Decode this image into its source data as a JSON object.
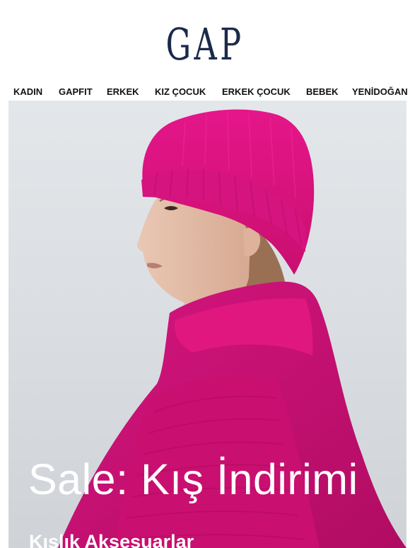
{
  "brand": {
    "logo_text": "GAP",
    "logo_color": "#1b2a4a"
  },
  "nav": {
    "items": [
      {
        "label": "KADIN"
      },
      {
        "label": "GAPFIT"
      },
      {
        "label": "ERKEK"
      },
      {
        "label": "KIZ ÇOCUK"
      },
      {
        "label": "ERKEK ÇOCUK"
      },
      {
        "label": "BEBEK"
      },
      {
        "label": "YENİDOĞAN"
      }
    ]
  },
  "hero": {
    "title": "Sale: Kış İndirimi",
    "subtitle": "Kışlık Aksesuarlar",
    "accent_color": "#e0167c",
    "background_color": "#dde1e5"
  }
}
